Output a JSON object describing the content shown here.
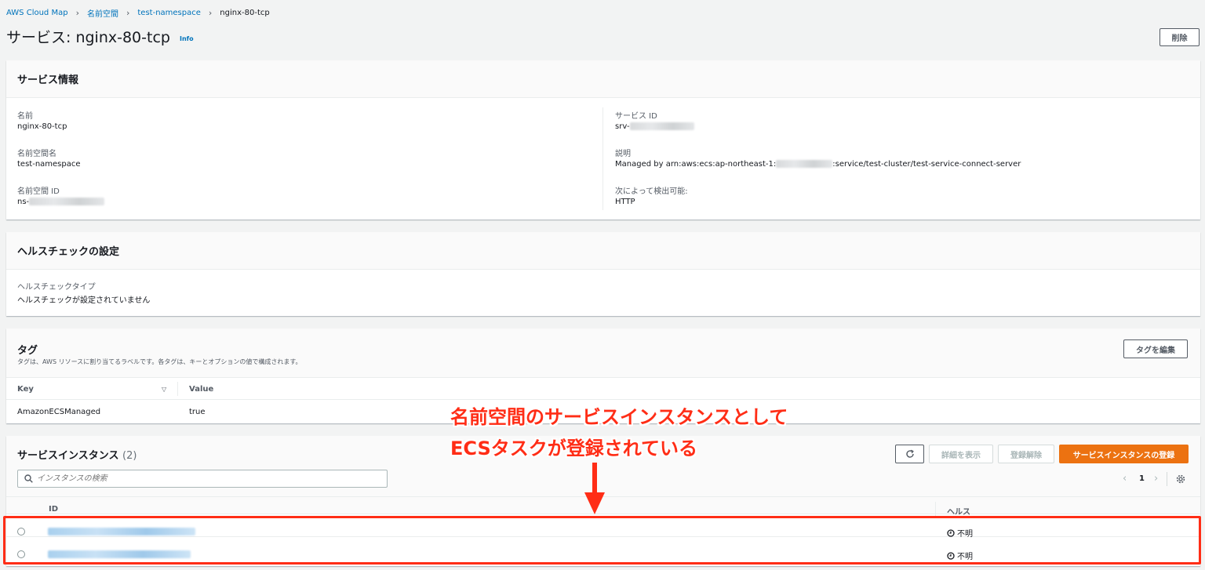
{
  "breadcrumb": {
    "items": [
      "AWS Cloud Map",
      "名前空間",
      "test-namespace"
    ],
    "current": "nginx-80-tcp"
  },
  "page": {
    "title": "サービス: nginx-80-tcp",
    "info": "Info",
    "delete_label": "削除"
  },
  "service_info": {
    "heading": "サービス情報",
    "name_label": "名前",
    "name_value": "nginx-80-tcp",
    "namespace_name_label": "名前空間名",
    "namespace_name_value": "test-namespace",
    "namespace_id_label": "名前空間 ID",
    "namespace_id_prefix": "ns-",
    "service_id_label": "サービス ID",
    "service_id_prefix": "srv-",
    "description_label": "説明",
    "description_prefix": "Managed by arn:aws:ecs:ap-northeast-1:",
    "description_suffix": ":service/test-cluster/test-service-connect-server",
    "discoverable_label": "次によって検出可能:",
    "discoverable_value": "HTTP"
  },
  "health_check": {
    "heading": "ヘルスチェックの設定",
    "type_label": "ヘルスチェックタイプ",
    "type_value": "ヘルスチェックが設定されていません"
  },
  "tags": {
    "heading": "タグ",
    "description": "タグは、AWS リソースに割り当てるラベルです。各タグは、キーとオプションの値で構成されます。",
    "edit_label": "タグを編集",
    "columns": [
      "Key",
      "Value"
    ],
    "rows": [
      {
        "key": "AmazonECSManaged",
        "value": "true"
      }
    ]
  },
  "instances": {
    "heading": "サービスインスタンス",
    "count": "(2)",
    "details_label": "詳細を表示",
    "deregister_label": "登録解除",
    "register_label": "サービスインスタンスの登録",
    "search_placeholder": "インスタンスの検索",
    "page_number": "1",
    "columns": [
      "ID",
      "ヘルス"
    ],
    "rows": [
      {
        "health": "不明"
      },
      {
        "health": "不明"
      }
    ]
  },
  "annotation": {
    "line1": "名前空間のサービスインスタンスとして",
    "line2": "ECSタスクが登録されている",
    "color": "#ff2d16"
  },
  "colors": {
    "link": "#0073bb",
    "primary": "#ec7211"
  }
}
